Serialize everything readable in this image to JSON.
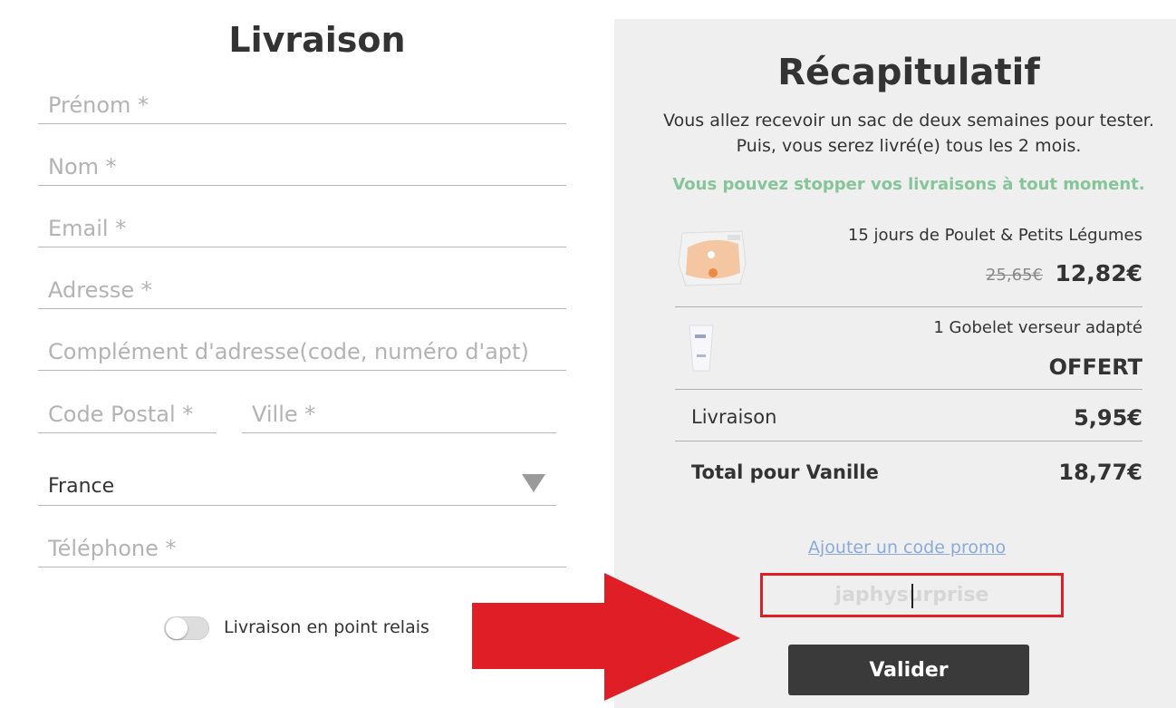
{
  "form": {
    "title": "Livraison",
    "fields": {
      "first_name": "Prénom *",
      "last_name": "Nom *",
      "email": "Email *",
      "address": "Adresse *",
      "address_extra": "Complément d'adresse(code, numéro d'apt)",
      "postal_code": "Code Postal *",
      "city": "Ville *",
      "phone": "Téléphone *"
    },
    "country_value": "France",
    "relay_toggle_label": "Livraison en point relais",
    "relay_toggle_on": false
  },
  "summary": {
    "title": "Récapitulatif",
    "intro_line1": "Vous allez recevoir un sac de deux semaines pour tester.",
    "intro_line2": "Puis, vous serez livré(e) tous les 2 mois.",
    "stop_note": "Vous pouvez stopper vos livraisons à tout moment.",
    "items": [
      {
        "name": "15 jours de Poulet & Petits Légumes",
        "old_price": "25,65€",
        "price": "12,82€"
      },
      {
        "name": "1 Gobelet verseur adapté",
        "price": "OFFERT"
      }
    ],
    "shipping_label": "Livraison",
    "shipping_value": "5,95€",
    "total_label": "Total pour Vanille",
    "total_value": "18,77€",
    "promo_link": "Ajouter un code promo",
    "promo_code_value": "japhysurprise",
    "validate_label": "Valider"
  },
  "colors": {
    "accent_green": "#86c49a",
    "annotation_red": "#e01e25",
    "button_dark": "#3a3a3a",
    "link_blue": "#8aaad8",
    "panel_gray": "#efefef"
  }
}
